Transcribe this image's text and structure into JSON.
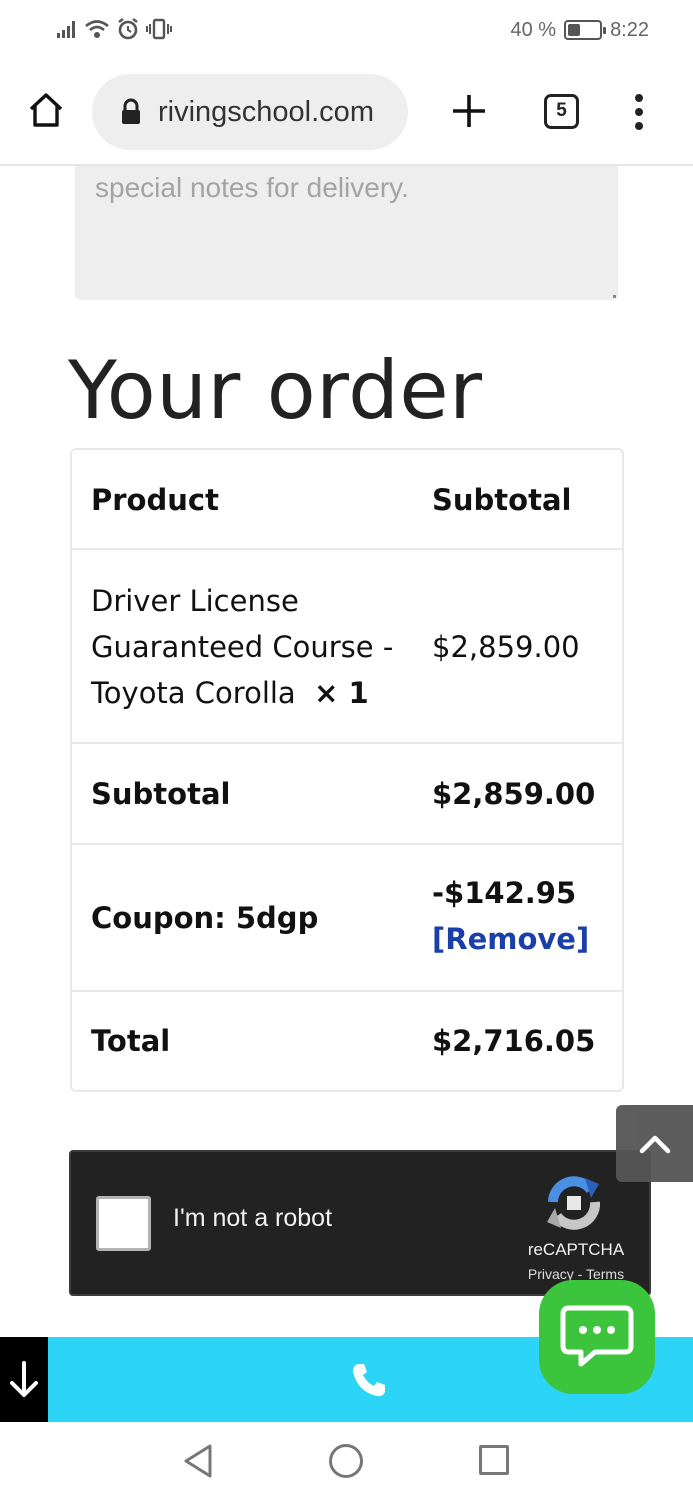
{
  "status_bar": {
    "battery_text": "40 %",
    "battery_level": 0.4,
    "time": "8:22",
    "icons": [
      "signal-icon",
      "wifi-icon",
      "alarm-icon",
      "vibrate-icon",
      "battery-icon"
    ]
  },
  "browser": {
    "url": "rivingschool.com",
    "tab_count": "5",
    "icons": [
      "home-icon",
      "lock-icon",
      "plus-icon",
      "tabs-icon",
      "menu-icon"
    ]
  },
  "notes": {
    "placeholder": "special notes for delivery."
  },
  "order": {
    "title": "Your order",
    "header": {
      "product": "Product",
      "subtotal": "Subtotal"
    },
    "item": {
      "name_line1": "Driver License",
      "name_line2": "Guaranteed Course -",
      "name_line3": "Toyota Corolla",
      "quantity": "× 1",
      "price": "$2,859.00"
    },
    "subtotal": {
      "label": "Subtotal",
      "value": "$2,859.00"
    },
    "coupon": {
      "label": "Coupon: 5dgp",
      "value": "-$142.95",
      "remove": "[Remove]"
    },
    "total": {
      "label": "Total",
      "value": "$2,716.05"
    },
    "colors": {
      "link": "#1a3fa8"
    }
  },
  "recaptcha": {
    "label": "I'm not a robot",
    "brand": "reCAPTCHA",
    "privacy": "Privacy",
    "separator": "-",
    "terms": "Terms"
  },
  "action_bar": {
    "colors": {
      "call_bar": "#2cd4f5",
      "chat": "#3cc43c"
    },
    "icons": [
      "arrow-down-icon",
      "phone-icon",
      "chat-icon",
      "chevron-up-icon"
    ]
  },
  "nav_bar": {
    "icons": [
      "back-icon",
      "home-circle-icon",
      "recents-icon"
    ]
  }
}
